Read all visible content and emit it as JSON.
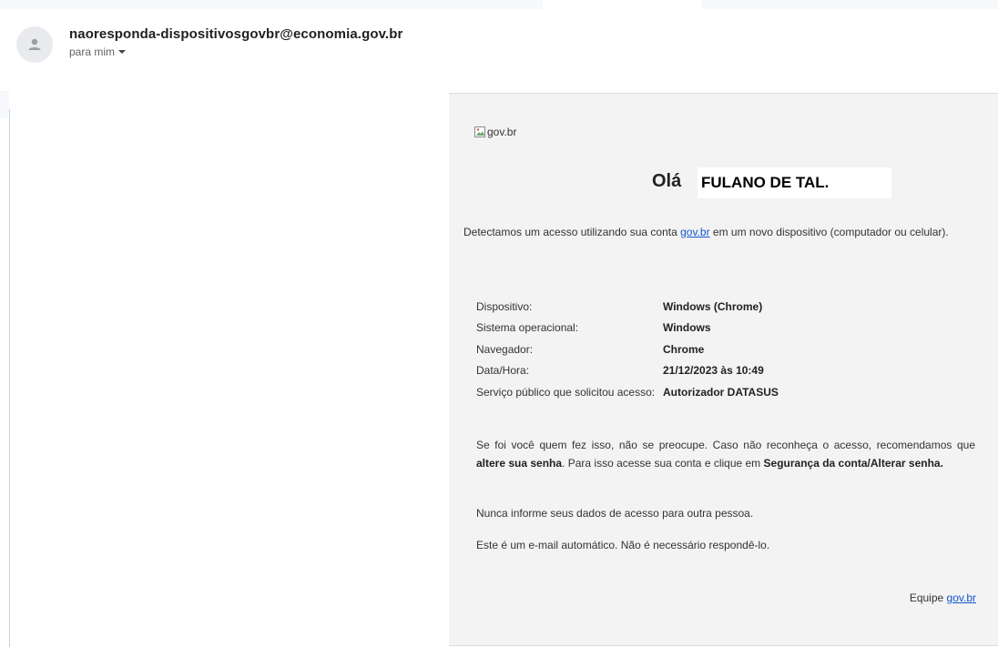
{
  "header": {
    "sender_email": "naoresponda-dispositivosgovbr@economia.gov.br",
    "recipient_label": "para mim",
    "avatar_icon": "person-icon",
    "dropdown_icon": "caret-down-icon"
  },
  "email": {
    "logo_alt": "gov.br",
    "greeting_prefix": "Olá",
    "greeting_name": "FULANO DE TAL.",
    "intro_before_link": "Detectamos um acesso utilizando sua conta ",
    "intro_link": "gov.br",
    "intro_after_link": " em um novo dispositivo (computador ou celular).",
    "details": [
      {
        "label": "Dispositivo:",
        "value": "Windows (Chrome)"
      },
      {
        "label": "Sistema operacional:",
        "value": "Windows"
      },
      {
        "label": "Navegador:",
        "value": "Chrome"
      },
      {
        "label": "Data/Hora:",
        "value": "21/12/2023 às 10:49"
      },
      {
        "label": "Serviço público que solicitou acesso:",
        "value": "Autorizador DATASUS"
      }
    ],
    "para1_a": "Se foi você quem fez isso, não se preocupe. Caso não reconheça o acesso, recomendamos que ",
    "para1_b": "altere sua senha",
    "para1_c": ". Para isso acesse sua conta e clique em ",
    "para1_d": "Segurança da conta/Alterar senha.",
    "para2": "Nunca informe seus dados de acesso para outra pessoa.",
    "para3": "Este é um e-mail automático. Não é necessário respondê-lo.",
    "signoff_prefix": "Equipe ",
    "signoff_link": "gov.br"
  },
  "colors": {
    "link": "#1155cc",
    "panel_background": "#f3f3f3"
  }
}
